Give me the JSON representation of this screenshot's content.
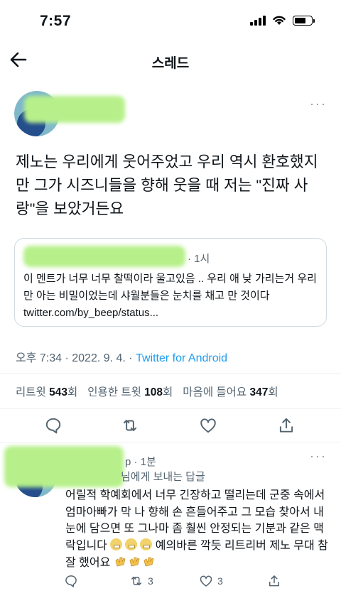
{
  "status_bar": {
    "time": "7:57"
  },
  "header": {
    "title": "스레드"
  },
  "tweet": {
    "more": "···",
    "text": "제노는 우리에게 웃어주었고 우리 역시 환호했지만 그가 시즈니들을 향해 웃을 때 저는 \"진짜 사랑\"을 보았거든요",
    "quote": {
      "time": "· 1시",
      "text": "이 멘트가 너무 너무 찰떡이라 울고있음 .. 우리 애 낮 가리는거 우리만 아는 비밀이었는데 샤월분들은 눈치를 채고 만 것이다 twitter.com/by_beep/status..."
    },
    "meta": {
      "datetime": "오후 7:34 · 2022. 9. 4. · ",
      "source": "Twitter for Android"
    },
    "stats": {
      "retweets_label": "리트윗",
      "retweets": "543",
      "retweets_unit": "회",
      "quotes_label": "인용한 트윗",
      "quotes": "108",
      "quotes_unit": "회",
      "likes_label": "마음에 들어요",
      "likes": "347",
      "likes_unit": "회"
    }
  },
  "reply": {
    "time": "p · 1분",
    "replying_to": "님에게 보내는 답글",
    "text_main": "어릴적 학예회에서 너무 긴장하고 떨리는데 군중 속에서 엄마아빠가 막 나 향해 손 흔들어주고 그 모습 찾아서 내 눈에 담으면 또 그나마 좀 훨씬 안정되는 기분과 같은 맥락입니다",
    "text_tail": "예의바른 깍듯 리트리버 제노 무대 참 잘 했어요",
    "retweets": "3",
    "likes": "3"
  },
  "icons": {
    "back": "arrow-left-icon",
    "more": "more-icon",
    "reply": "comment-icon",
    "retweet": "retweet-icon",
    "like": "heart-icon",
    "share": "share-icon"
  },
  "colors": {
    "link": "#1d9bf0",
    "secondary": "#536471",
    "redaction": "#b7f08a"
  }
}
